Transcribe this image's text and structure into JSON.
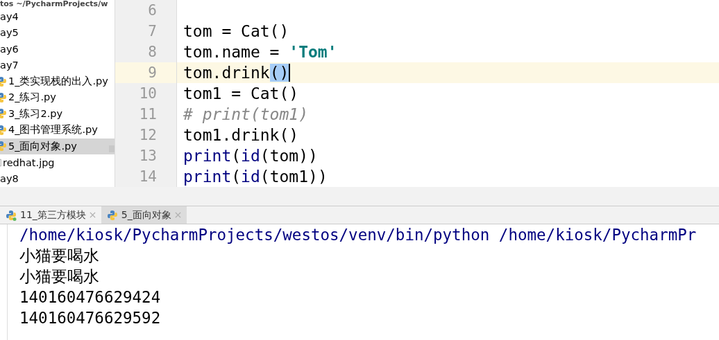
{
  "project_header": "tos ~/PycharmProjects/w",
  "tree": [
    {
      "label": "ay4",
      "kind": "folder",
      "selected": false
    },
    {
      "label": "ay5",
      "kind": "folder",
      "selected": false
    },
    {
      "label": "ay6",
      "kind": "folder",
      "selected": false
    },
    {
      "label": "ay7",
      "kind": "folder",
      "selected": false
    },
    {
      "label": "1_类实现栈的出入.py",
      "kind": "python",
      "selected": false
    },
    {
      "label": "2_练习.py",
      "kind": "python",
      "selected": false
    },
    {
      "label": "3_练习2.py",
      "kind": "python",
      "selected": false
    },
    {
      "label": "4_图书管理系统.py",
      "kind": "python",
      "selected": false
    },
    {
      "label": "5_面向对象.py",
      "kind": "python",
      "selected": true
    },
    {
      "label": "redhat.jpg",
      "kind": "image",
      "selected": false
    },
    {
      "label": "ay8",
      "kind": "folder",
      "selected": false
    }
  ],
  "editor": {
    "lines": [
      {
        "number": "6",
        "current": false
      },
      {
        "number": "7",
        "current": false,
        "tokens": [
          {
            "text": "tom = Cat()",
            "kind": "plain"
          }
        ]
      },
      {
        "number": "8",
        "current": false,
        "tokens": [
          {
            "text": "tom.name = ",
            "kind": "plain"
          },
          {
            "text": "'Tom'",
            "kind": "string"
          }
        ]
      },
      {
        "number": "9",
        "current": true,
        "tokens": [
          {
            "text": "tom.drink",
            "kind": "plain"
          },
          {
            "text": "()",
            "kind": "selected"
          }
        ]
      },
      {
        "number": "10",
        "current": false,
        "tokens": [
          {
            "text": "tom1 = Cat()",
            "kind": "plain"
          }
        ]
      },
      {
        "number": "11",
        "current": false,
        "tokens": [
          {
            "text": "# print(tom1)",
            "kind": "comment"
          }
        ]
      },
      {
        "number": "12",
        "current": false,
        "tokens": [
          {
            "text": "tom1.drink()",
            "kind": "plain"
          }
        ]
      },
      {
        "number": "13",
        "current": false,
        "tokens": [
          {
            "text": "print",
            "kind": "builtin"
          },
          {
            "text": "(",
            "kind": "plain"
          },
          {
            "text": "id",
            "kind": "builtin"
          },
          {
            "text": "(tom))",
            "kind": "plain"
          }
        ]
      },
      {
        "number": "14",
        "current": false,
        "tokens": [
          {
            "text": "print",
            "kind": "builtin"
          },
          {
            "text": "(",
            "kind": "plain"
          },
          {
            "text": "id",
            "kind": "builtin"
          },
          {
            "text": "(tom1))",
            "kind": "plain"
          }
        ]
      }
    ]
  },
  "run_tabs": [
    {
      "label": "11_第三方模块",
      "selected": false,
      "running": true
    },
    {
      "label": "5_面向对象",
      "selected": true,
      "running": false
    }
  ],
  "console": [
    {
      "text": "/home/kiosk/PycharmProjects/westos/venv/bin/python /home/kiosk/PycharmPr",
      "kind": "command"
    },
    {
      "text": "小猫要喝水",
      "kind": "output"
    },
    {
      "text": "小猫要喝水",
      "kind": "output"
    },
    {
      "text": "140160476629424",
      "kind": "output"
    },
    {
      "text": "140160476629592",
      "kind": "output"
    }
  ]
}
